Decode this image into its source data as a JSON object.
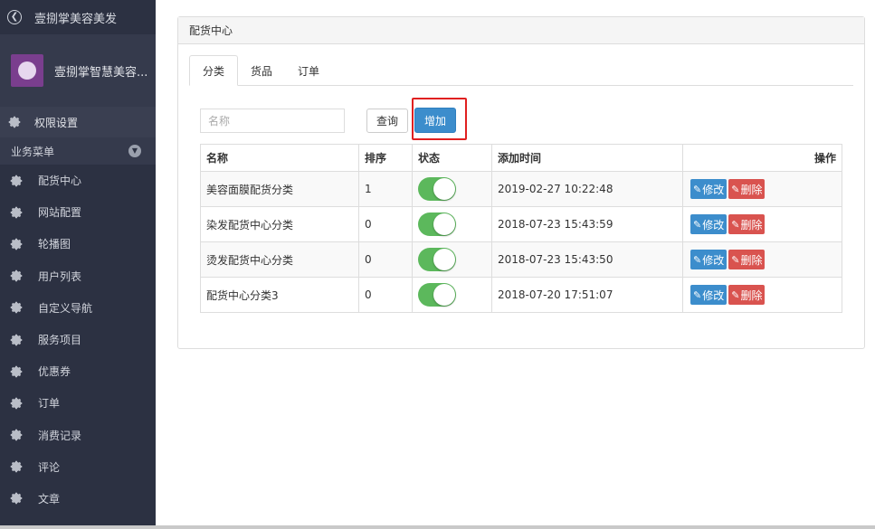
{
  "sidebar": {
    "brand_title": "壹捌掌美容美发",
    "profile_name": "壹捌掌智慧美容...",
    "perm_label": "权限设置",
    "menu_header": "业务菜单",
    "items": [
      {
        "label": "配货中心"
      },
      {
        "label": "网站配置"
      },
      {
        "label": "轮播图"
      },
      {
        "label": "用户列表"
      },
      {
        "label": "自定义导航"
      },
      {
        "label": "服务项目"
      },
      {
        "label": "优惠券"
      },
      {
        "label": "订单"
      },
      {
        "label": "消费记录"
      },
      {
        "label": "评论"
      },
      {
        "label": "文章"
      }
    ]
  },
  "panel": {
    "title": "配货中心",
    "tabs": [
      "分类",
      "货品",
      "订单"
    ],
    "active_tab": 0
  },
  "search": {
    "placeholder": "名称",
    "value": "",
    "query_label": "查询",
    "add_label": "增加"
  },
  "table": {
    "headers": [
      "名称",
      "排序",
      "状态",
      "添加时间",
      "操作"
    ],
    "edit_label": "修改",
    "delete_label": "删除",
    "rows": [
      {
        "name": "美容面膜配货分类",
        "sort": "1",
        "status_on": true,
        "time": "2019-02-27 10:22:48"
      },
      {
        "name": "染发配货中心分类",
        "sort": "0",
        "status_on": true,
        "time": "2018-07-23 15:43:59"
      },
      {
        "name": "烫发配货中心分类",
        "sort": "0",
        "status_on": true,
        "time": "2018-07-23 15:43:50"
      },
      {
        "name": "配货中心分类3",
        "sort": "0",
        "status_on": true,
        "time": "2018-07-20 17:51:07"
      }
    ]
  },
  "colors": {
    "sidebar_bg": "#2c3142",
    "primary": "#3c8dcc",
    "danger": "#d9534f",
    "toggle_on": "#5cb85c",
    "highlight": "#e02020"
  }
}
